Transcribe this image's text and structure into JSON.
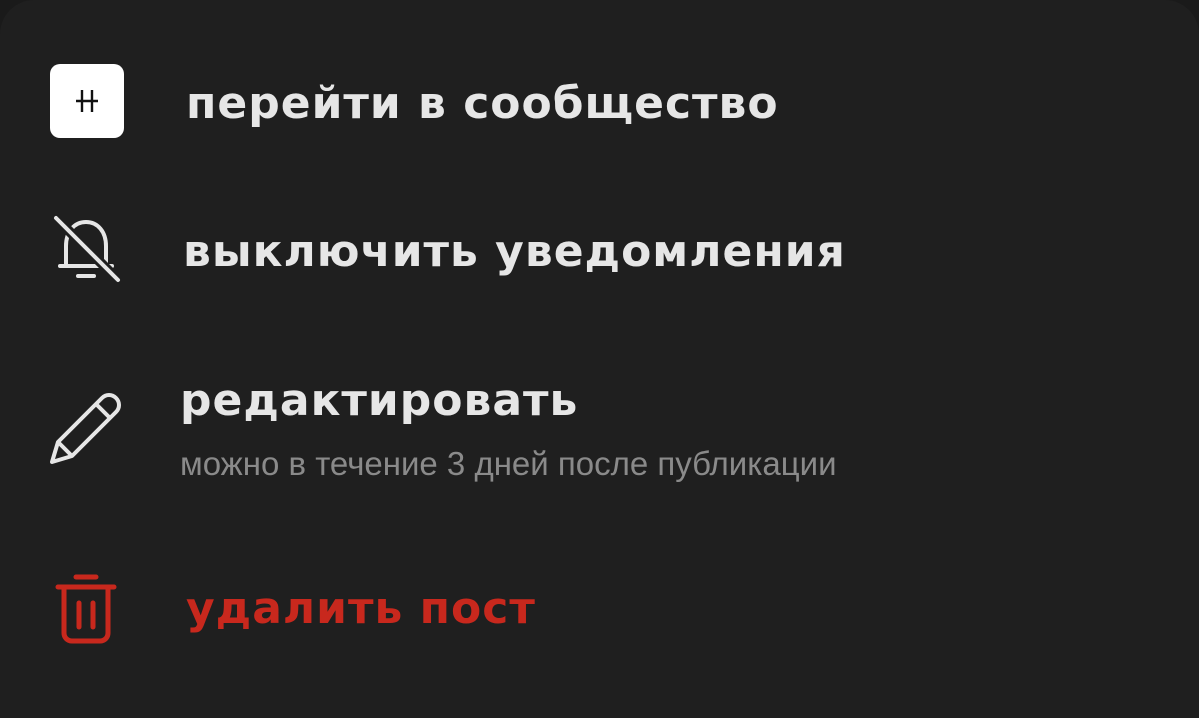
{
  "menu": {
    "items": [
      {
        "id": "go-community",
        "label": "перейти в сообщество",
        "icon": "community-logo",
        "logo_text": "H"
      },
      {
        "id": "mute",
        "label": "выключить уведомления",
        "icon": "bell-off-icon"
      },
      {
        "id": "edit",
        "label": "редактировать",
        "sublabel": "можно в течение 3 дней после публикации",
        "icon": "pencil-icon"
      },
      {
        "id": "delete",
        "label": "удалить пост",
        "icon": "trash-icon"
      }
    ]
  },
  "colors": {
    "background": "#1f1f1f",
    "text": "#e6e6e6",
    "muted": "#8a8a8a",
    "danger": "#c8281d"
  }
}
